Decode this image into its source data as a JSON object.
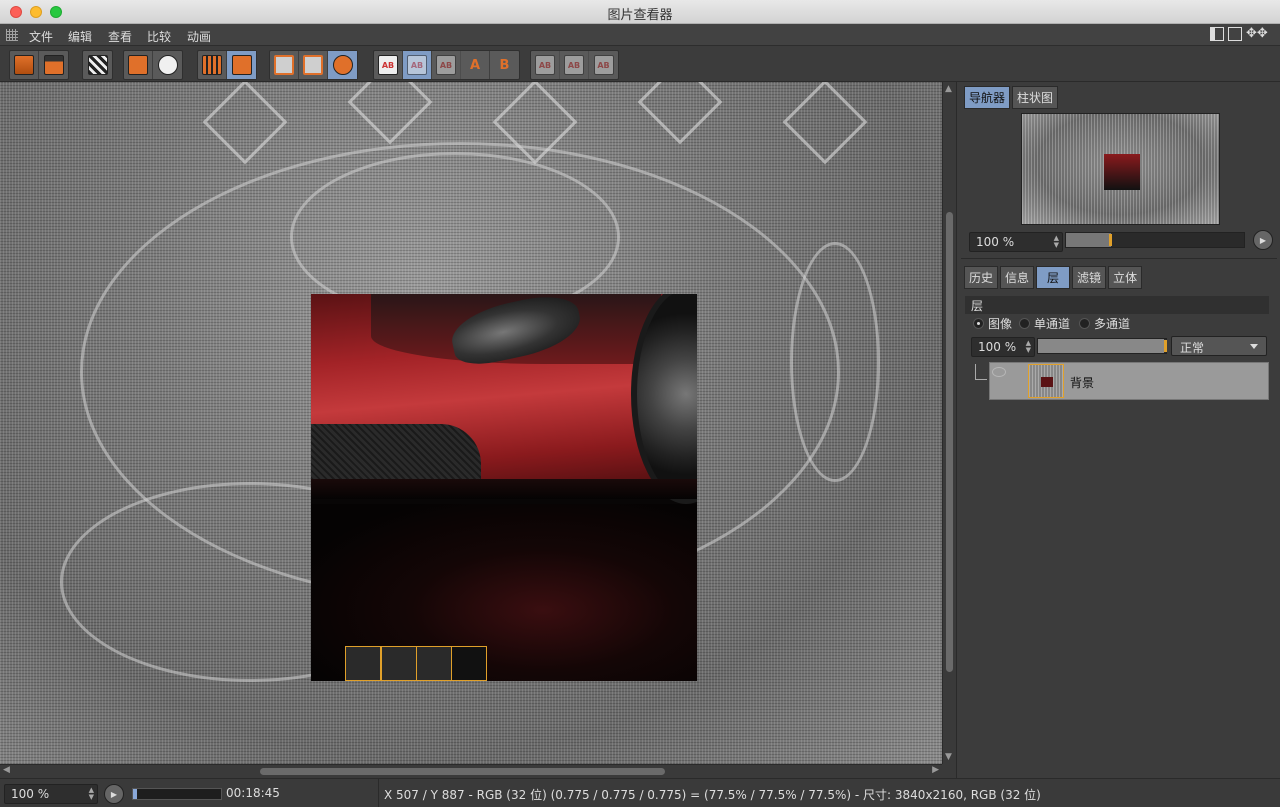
{
  "window": {
    "title": "图片查看器"
  },
  "menu": {
    "items": [
      "文件",
      "编辑",
      "查看",
      "比较",
      "动画"
    ]
  },
  "toolbar": {
    "icons": [
      "open-file-icon",
      "save-icon",
      "clapper-icon",
      "layout-export-icon",
      "magnifier-icon",
      "delete-icon",
      "stack-icon",
      "frame-region-icon",
      "frame-all-icon",
      "compare-icon",
      "ab-compare-icon",
      "ab-swap-icon",
      "ab-grey-icon",
      "set-a-icon",
      "set-b-icon",
      "ab-view1-icon",
      "ab-view2-icon",
      "ab-view3-icon"
    ],
    "letter_a": "A",
    "letter_b": "B",
    "ab_text": "AB"
  },
  "right_panel": {
    "top_tabs": [
      "导航器",
      "柱状图"
    ],
    "top_active": 0,
    "nav_zoom": "100 %",
    "mid_tabs": [
      "历史",
      "信息",
      "层",
      "滤镜",
      "立体"
    ],
    "mid_active": 2,
    "layer_section": "层",
    "radio_options": [
      "图像",
      "单通道",
      "多通道"
    ],
    "radio_selected": 0,
    "layer_opacity": "100 %",
    "blend_mode": "正常",
    "layer_name": "背景"
  },
  "status": {
    "zoom": "100 %",
    "progress": 0.04,
    "time": "00:18:45",
    "info": "X 507 / Y 887 - RGB (32 位) (0.775 / 0.775 / 0.775) = (77.5% / 77.5% / 77.5%) - 尺寸: 3840x2160, RGB (32 位)"
  },
  "colors": {
    "accent": "#e0702a",
    "selection": "#7f9cc5",
    "tile_border": "#e0a02a"
  }
}
